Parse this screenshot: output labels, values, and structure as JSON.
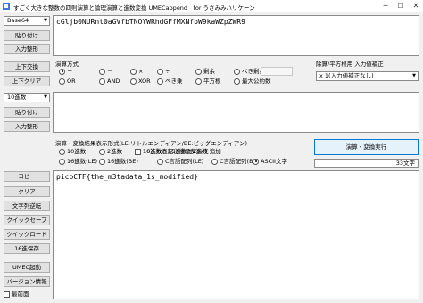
{
  "window": {
    "title": "すごく大きな整数の四則演算と論理演算と進数変換 UMECappend　for うさみみハリケーン",
    "minimize": "─",
    "maximize": "☐",
    "close": "✕"
  },
  "input1": {
    "base": "Base64",
    "value": "cGljb0NURnt0aGVfbTNOYWRhdGFfMXNfbW9kaWZpZWR9",
    "paste_label": "貼り付け",
    "format_label": "入力整形",
    "swap_label": "上下交換",
    "clear_label": "上下クリア"
  },
  "operation": {
    "header": "演算方式",
    "options": [
      {
        "label": "＋",
        "selected": true
      },
      {
        "label": "－",
        "selected": false
      },
      {
        "label": "×",
        "selected": false
      },
      {
        "label": "÷",
        "selected": false
      },
      {
        "label": "剰余",
        "selected": false
      },
      {
        "label": "べき剰余",
        "selected": false
      },
      {
        "label": "OR",
        "selected": false
      },
      {
        "label": "AND",
        "selected": false
      },
      {
        "label": "XOR",
        "selected": false
      },
      {
        "label": "べき乗",
        "selected": false
      },
      {
        "label": "平方根",
        "selected": false
      },
      {
        "label": "最大公約数",
        "selected": false
      }
    ],
    "modulus_value": ""
  },
  "correction": {
    "header": "除算/平方根用 入力値補正",
    "value": "x 1(入力値補正なし)"
  },
  "input2": {
    "base": "10進数",
    "value": "",
    "paste_label": "貼り付け",
    "format_label": "入力整形"
  },
  "result_format": {
    "header": "演算・変換結果表示形式(LE:リトルエンディアン/BE:ビッグエンディアン)",
    "options": [
      {
        "label": "10進数",
        "selected": false
      },
      {
        "label": "2進数",
        "selected": false
      },
      {
        "label": "10進数と16進数と2進数",
        "selected": false
      },
      {
        "label": "16進数(LE)",
        "selected": false
      },
      {
        "label": "16進数(BE)",
        "selected": false
      },
      {
        "label": "C言語配列(LE)",
        "selected": false
      },
      {
        "label": "C言語配列(BE)",
        "selected": false
      },
      {
        "label": "ASCII文字",
        "selected": true
      }
    ],
    "prefix_check_label": "16進数表記に接頭辞0xを追加",
    "prefix_checked": false
  },
  "execute": {
    "label": "演算・変換実行",
    "char_count": "33文字"
  },
  "output": {
    "value": "picoCTF{the_m3tadata_1s_modified}",
    "buttons": {
      "copy": "コピー",
      "clear": "クリア",
      "reverse": "文字列逆転",
      "quick_save": "クイックセーブ",
      "quick_load": "クイックロード",
      "hex_save": "16進保存",
      "umec_start": "UMEC起動",
      "version": "バージョン情報"
    },
    "topmost_label": "最前面",
    "topmost_checked": false
  }
}
